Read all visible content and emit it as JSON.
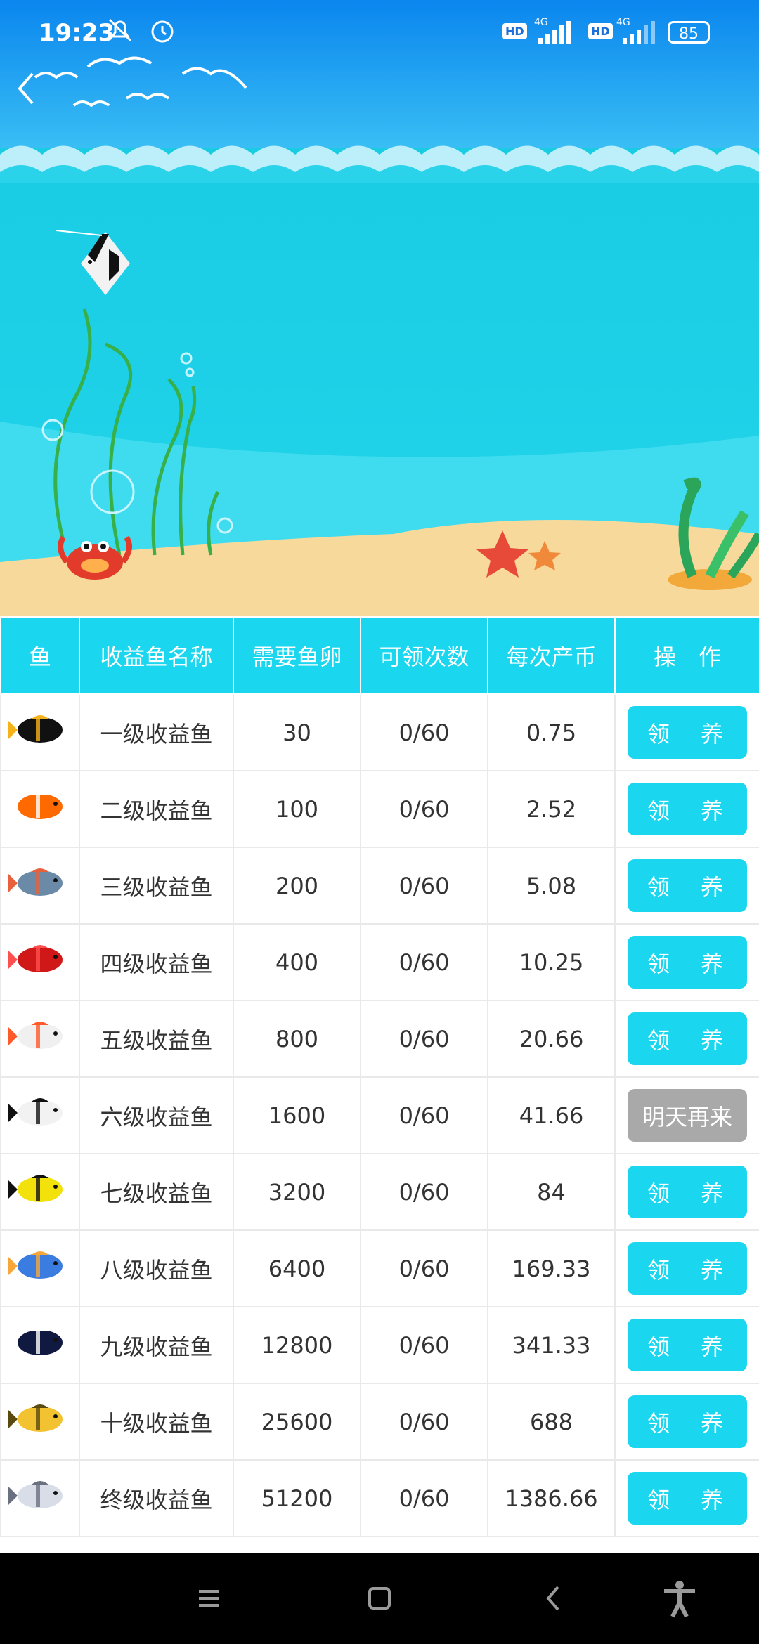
{
  "status": {
    "time": "19:23",
    "network1": "4G",
    "network2": "4G",
    "hd_badge": "HD",
    "battery": "85"
  },
  "table": {
    "headers": [
      "鱼",
      "收益鱼名称",
      "需要鱼卵",
      "可领次数",
      "每次产币",
      "操　作"
    ],
    "rows": [
      {
        "name": "一级收益鱼",
        "eggs": "30",
        "claims": "0/60",
        "coins": "0.75",
        "action": "领　养",
        "enabled": true
      },
      {
        "name": "二级收益鱼",
        "eggs": "100",
        "claims": "0/60",
        "coins": "2.52",
        "action": "领　养",
        "enabled": true
      },
      {
        "name": "三级收益鱼",
        "eggs": "200",
        "claims": "0/60",
        "coins": "5.08",
        "action": "领　养",
        "enabled": true
      },
      {
        "name": "四级收益鱼",
        "eggs": "400",
        "claims": "0/60",
        "coins": "10.25",
        "action": "领　养",
        "enabled": true
      },
      {
        "name": "五级收益鱼",
        "eggs": "800",
        "claims": "0/60",
        "coins": "20.66",
        "action": "领　养",
        "enabled": true
      },
      {
        "name": "六级收益鱼",
        "eggs": "1600",
        "claims": "0/60",
        "coins": "41.66",
        "action": "明天再来",
        "enabled": false
      },
      {
        "name": "七级收益鱼",
        "eggs": "3200",
        "claims": "0/60",
        "coins": "84",
        "action": "领　养",
        "enabled": true
      },
      {
        "name": "八级收益鱼",
        "eggs": "6400",
        "claims": "0/60",
        "coins": "169.33",
        "action": "领　养",
        "enabled": true
      },
      {
        "name": "九级收益鱼",
        "eggs": "12800",
        "claims": "0/60",
        "coins": "341.33",
        "action": "领　养",
        "enabled": true
      },
      {
        "name": "十级收益鱼",
        "eggs": "25600",
        "claims": "0/60",
        "coins": "688",
        "action": "领　养",
        "enabled": true
      },
      {
        "name": "终级收益鱼",
        "eggs": "51200",
        "claims": "0/60",
        "coins": "1386.66",
        "action": "领　养",
        "enabled": true
      }
    ]
  },
  "fish_colors": [
    [
      "#111111",
      "#f6b21a"
    ],
    [
      "#ff6a00",
      "#ffffff"
    ],
    [
      "#6a8aa8",
      "#e8603c"
    ],
    [
      "#d01818",
      "#ff5050"
    ],
    [
      "#f0f0f0",
      "#ff5a2a"
    ],
    [
      "#f2f2f2",
      "#111111"
    ],
    [
      "#f2e10a",
      "#111111"
    ],
    [
      "#3a7ce0",
      "#f7a73a"
    ],
    [
      "#101a40",
      "#ffffff"
    ],
    [
      "#f2c230",
      "#5a4a10"
    ],
    [
      "#d8dde8",
      "#6a7080"
    ]
  ],
  "colors": {
    "accent": "#1ad6ef",
    "disabled": "#a9a9a9",
    "sky": "#0a90f0",
    "sea": "#19cfe6",
    "sand": "#f7d99b"
  },
  "icons": {
    "back": "back-arrow-icon",
    "menu": "menu-icon",
    "home": "home-icon",
    "nav_back": "nav-back-icon",
    "accessibility": "accessibility-icon"
  }
}
